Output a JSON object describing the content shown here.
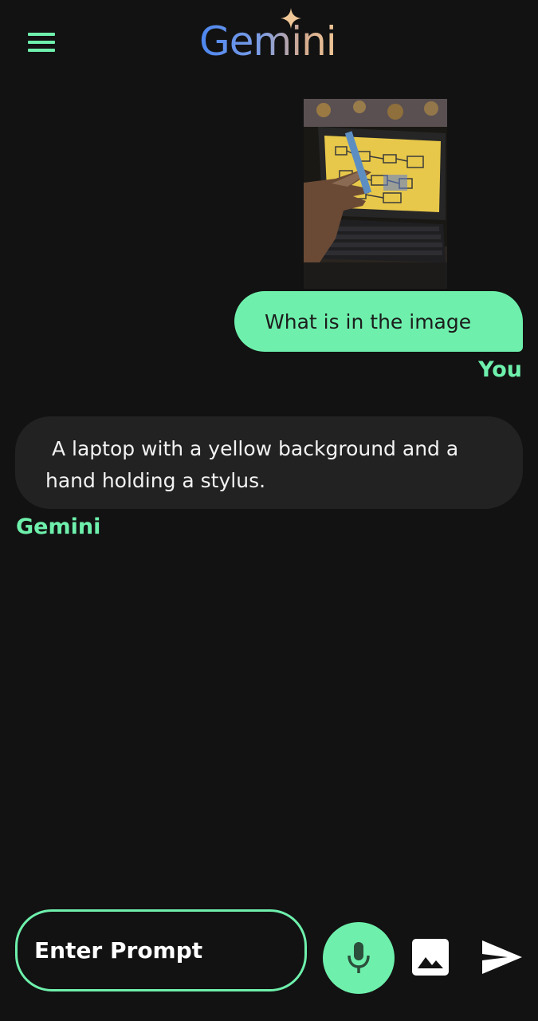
{
  "header": {
    "menu_icon": "hamburger-menu-icon",
    "logo_text": "Gemini",
    "logo_icon": "sparkle-icon"
  },
  "messages": [
    {
      "role": "user",
      "attachment": "photo of a laptop with a yellow screen and a hand",
      "text": "What is in the image",
      "sender_label": "You"
    },
    {
      "role": "assistant",
      "text": " A laptop with a yellow background and a\nhand holding a stylus.",
      "sender_label": "Gemini"
    }
  ],
  "composer": {
    "placeholder": "Enter Prompt",
    "value": "",
    "mic_icon": "microphone-icon",
    "image_icon": "image-icon",
    "send_icon": "send-icon"
  },
  "colors": {
    "background": "#121212",
    "accent": "#6ef0ac",
    "bot_bubble": "#222222",
    "user_bubble_text": "#1c1c1c"
  }
}
